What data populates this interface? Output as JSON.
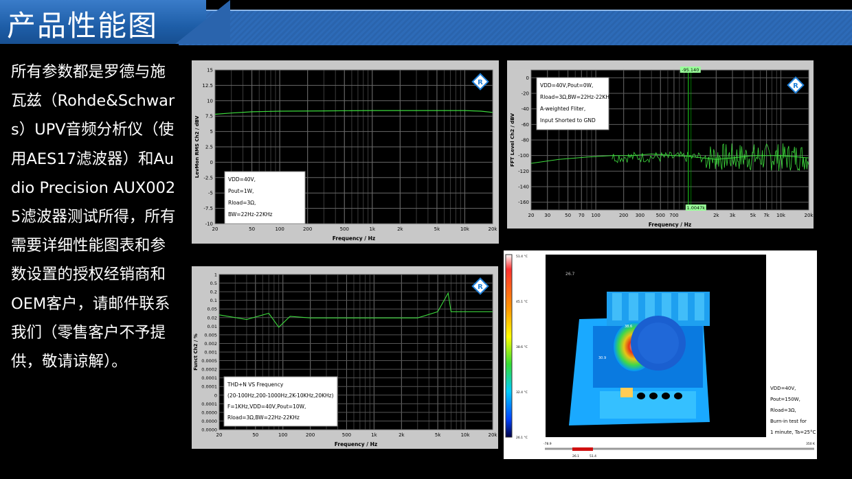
{
  "header": {
    "title": "产品性能图"
  },
  "description": "所有参数都是罗德与施瓦兹（Rohde&Schwars）UPV音频分析仪（使用AES17滤波器）和Audio Precision AUX0025滤波器测试所得，所有需要详细性能图表和参数设置的授权经销商和OEM客户，请邮件联系我们（零售客户不予提供，敬请谅解）。",
  "colors": {
    "accent": "#2a64ad",
    "trace": "#3ddc3d",
    "marker": "#00c000"
  },
  "chart_data": [
    {
      "type": "line",
      "xlabel": "Frequency / Hz",
      "ylabel": "LevMon RMS Ch2 / dBV",
      "x_scale": "log",
      "xlim": [
        20,
        20000
      ],
      "ylim": [
        -10,
        15
      ],
      "x_ticks": [
        20,
        50,
        100,
        200,
        500,
        1000,
        2000,
        5000,
        10000,
        20000
      ],
      "x_tick_labels": [
        "20",
        "50",
        "100",
        "200",
        "500",
        "1k",
        "2k",
        "5k",
        "10k",
        "20k"
      ],
      "y_ticks": [
        15,
        12.5,
        10,
        7.5,
        5,
        2.5,
        0,
        -2.5,
        -5,
        -7.5,
        -10
      ],
      "series": [
        {
          "x": [
            20,
            30,
            50,
            100,
            300,
            1000,
            3000,
            10000,
            15000,
            20000
          ],
          "y": [
            7.8,
            8.0,
            8.2,
            8.3,
            8.35,
            8.4,
            8.4,
            8.4,
            8.3,
            8.1
          ]
        }
      ],
      "annotation": [
        "VDD=40V,",
        "Pout=1W,",
        "Rload=3Ω,",
        "BW=22Hz-22KHz"
      ]
    },
    {
      "type": "line",
      "xlabel": "Frequency / Hz",
      "ylabel": "FFT Level Ch2 / dBV",
      "x_scale": "log",
      "xlim": [
        20,
        20000
      ],
      "ylim": [
        -170,
        10
      ],
      "x_ticks": [
        20,
        30,
        50,
        70,
        100,
        200,
        300,
        500,
        700,
        1000,
        2000,
        3000,
        5000,
        7000,
        10000,
        20000
      ],
      "x_tick_labels": [
        "20",
        "30",
        "50",
        "70",
        "100",
        "200",
        "300",
        "500",
        "700",
        "",
        "2k",
        "3k",
        "5k",
        "7k",
        "10k",
        "20k"
      ],
      "y_ticks": [
        0,
        -20,
        -40,
        -60,
        -80,
        -100,
        -120,
        -140,
        -160
      ],
      "marker_x": 1000,
      "marker_top_label": "-95.140",
      "marker_bottom_label": "1.0047k",
      "series": [
        {
          "x": [
            20,
            40,
            80,
            150,
            250,
            400,
            700,
            1000,
            2000,
            3000,
            5000,
            10000,
            20000
          ],
          "y": [
            -110,
            -105,
            -102,
            -100,
            -100,
            -98,
            -100,
            -101,
            -105,
            -103,
            -100,
            -100,
            -103
          ],
          "noise_from": 1500,
          "noise_amp": 18
        }
      ],
      "annotation": [
        "VDD=40V,Pout=0W,",
        "Rload=3Ω,BW=22Hz-22KHz,",
        "A-weighted Fliter,",
        "Input Shorted to GND"
      ]
    },
    {
      "type": "line",
      "xlabel": "Frequency / Hz",
      "ylabel": "Funct Ch2 / %",
      "x_scale": "log",
      "xlim": [
        20,
        20000
      ],
      "x_ticks": [
        20,
        50,
        100,
        200,
        500,
        1000,
        2000,
        5000,
        10000,
        20000
      ],
      "x_tick_labels": [
        "20",
        "50",
        "100",
        "200",
        "500",
        "1k",
        "2k",
        "5k",
        "10k",
        "20k"
      ],
      "y_tick_labels": [
        "1",
        "0.5",
        "0.2",
        "0.1",
        "0.05",
        "0.02",
        "0.01",
        "0.005",
        "0.002",
        "0.001",
        "0.0005",
        "0.0002",
        "0.0001",
        "0.0001",
        "0",
        "0.0001",
        "0.0000",
        "0.0000",
        "0.0000"
      ],
      "series": [
        {
          "x": [
            20,
            40,
            70,
            90,
            120,
            200,
            500,
            1000,
            2000,
            3000,
            5000,
            6500,
            7000,
            10000,
            20000
          ],
          "y_level": [
            0.78,
            0.75,
            0.79,
            0.7,
            0.77,
            0.76,
            0.76,
            0.76,
            0.76,
            0.76,
            0.8,
            0.92,
            0.8,
            0.8,
            0.8
          ]
        }
      ],
      "annotation": [
        "THD+N VS Frequency",
        "(20-100Hz,200-1000Hz,2K-10KHz,20KHz)",
        "F=1KHz,VDD=40V,Pout=10W,",
        "Rload=3Ω,BW=22Hz-22KHz"
      ]
    }
  ],
  "thermal": {
    "scale_labels": [
      "51.4 °C",
      "45.1 °C",
      "38.6 °C",
      "32.4 °C",
      "26.1 °C"
    ],
    "spot_labels": [
      "26.7",
      "38.6",
      "30.9"
    ],
    "range_left": "-78.9",
    "range_right": "350 K",
    "range_low": "26.1",
    "range_high": "51.4",
    "annotation": [
      "VDD=40V,",
      "Pout=150W,",
      "Rload=3Ω,",
      "Burn-in test for",
      "1 minute, Ta=25°C"
    ]
  }
}
